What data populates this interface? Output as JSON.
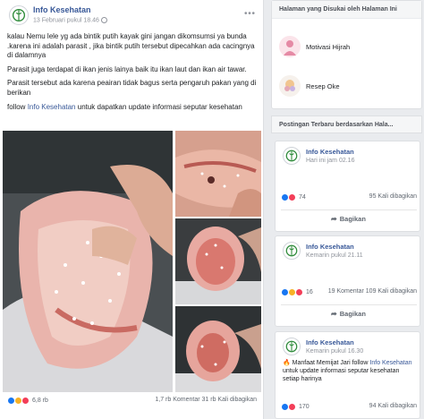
{
  "post": {
    "page_name": "Info Kesehatan",
    "time": "13 Februari pukul 18.46",
    "menu_icon": "more-dots-icon",
    "paragraphs": [
      "kalau Nemu lele yg ada bintik putih kayak gini jangan dikomsumsi ya bunda .karena ini adalah parasit , jika bintik putih tersebut dipecahkan ada cacingnya di dalamnya",
      "Parasit juga terdapat di ikan jenis lainya baik itu ikan laut dan ikan air tawar.",
      "Parasit tersebut ada karena peairan tidak bagus serta pengaruh pakan yang di berikan"
    ],
    "follow_prefix": "follow ",
    "follow_link": "Info Kesehatan",
    "follow_suffix": " untuk dapatkan update informasi seputar kesehatan",
    "reaction_count": "6,8 rb",
    "stats": "1,7 rb Komentar  31 rb Kali dibagikan"
  },
  "liked_pages": {
    "title": "Halaman yang Disukai oleh Halaman Ini",
    "items": [
      {
        "name": "Motivasi Hijrah"
      },
      {
        "name": "Resep Oke"
      }
    ]
  },
  "recent_posts": {
    "title": "Postingan Terbaru berdasarkan Hala...",
    "share_label": "Bagikan",
    "cards": [
      {
        "name": "Info Kesehatan",
        "time": "Hari ini jam 02.16",
        "reactions": "74",
        "comments": "95 Kali dibagikan"
      },
      {
        "name": "Info Kesehatan",
        "time": "Kemarin pukul 21.11",
        "reactions": "16",
        "comments": "19 Komentar  109 Kali dibagikan"
      },
      {
        "name": "Info Kesehatan",
        "time": "Kemarin pukul 16.30",
        "text_prefix": "🔥 Manfaat Memijat Jari follow ",
        "text_link": "Info Kesehatan",
        "text_suffix": " untuk update informasi seputar kesehatan setiap harinya",
        "reactions": "170",
        "comments": "94 Kali dibagikan"
      }
    ]
  },
  "colors": {
    "link": "#385898",
    "like": "#1877f2",
    "love": "#f33e58",
    "wow": "#f7b125"
  }
}
